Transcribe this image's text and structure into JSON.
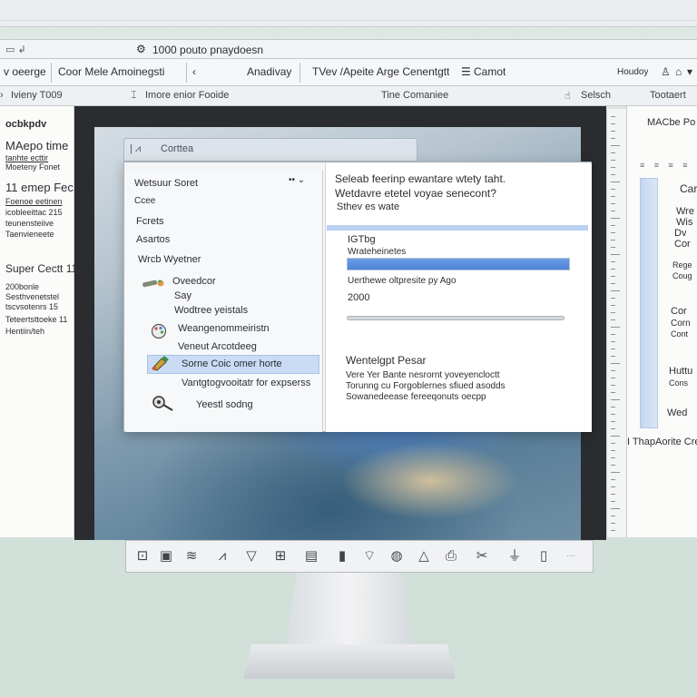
{
  "title_bar": {
    "menu_icon": "menu-icon",
    "logo_icon": "cog-logo-icon",
    "title": "1000 pouto pnaydoesn"
  },
  "tab_bar": {
    "tabs": [
      "v oeerge",
      "Coor Mele Amoinegsti",
      "Anadivay",
      "TVev /Apeite Arge Cenentgtt",
      "Camot"
    ],
    "right_label": "Houdoy",
    "right_icons": [
      "user-icon",
      "lock-icon",
      "chevron-down-icon"
    ]
  },
  "toolbar": {
    "left_label": "Ivieny T009",
    "center_label": "Imore enior Fooide",
    "time_label": "Tine Comaniee",
    "select_label": "Selsch",
    "right_label": "Tootaert"
  },
  "left_panel": {
    "heading": "ocbkpdv",
    "title": "MAepo time",
    "lines": [
      "tanhte ecttir",
      "Moeteny Fonet"
    ],
    "subhead": "11 emep Fec",
    "sublines": [
      "Foenoe eetinen",
      "icobleeittac 215",
      "teunensteiive",
      "Taenvieneete"
    ],
    "section": "Super Cectt 11",
    "section_lines": [
      "200bonle",
      "Sesthvenetstel",
      "tscvsotenrs 15",
      "Teteertsttoeke 11",
      "Hentiin/teh"
    ]
  },
  "right_panel": {
    "title": "MACbe Po",
    "lines": [
      "Car",
      "Wre",
      "Wis",
      "Dv",
      "Cor",
      "Rege",
      "Coug",
      "Cor",
      "Corn",
      "Cont",
      "Huttu",
      "Cons",
      "Wed"
    ],
    "footer": "I ThapAorite Cre"
  },
  "back_window": {
    "title": "Corttea"
  },
  "dialog": {
    "left": {
      "header": "Wetsuur Soret",
      "items": [
        "Ccee",
        "Fcrets",
        "Asartos",
        "Wrcb Wyetner",
        "Oveedcor",
        "Say",
        "Wodtree yeistals",
        "Weangenommeiristn",
        "Veneut Arcotdeeg",
        "Sorne Coic omer horte",
        "Vantgtogvooitatr for expserss",
        "Yeestl sodng"
      ],
      "selected_index": 9
    },
    "right": {
      "heading_line1": "Seleab feerinp ewantare wtety taht.",
      "heading_line2": "Wetdavre etetel voyae senecont?",
      "subheading": "Sthev es wate",
      "field_label": "IGTbg",
      "field_value": "Wrateheinetes",
      "progress_percent": 100,
      "progress_caption": "Uerthewe oltpresite py Ago",
      "number_value": "2000",
      "section_title": "Wentelgpt Pesar",
      "section_lines": [
        "Vere Yer Bante nesrornt yoveyencloctt",
        "Torunng cu Forgoblernes sfiued asodds",
        "Sowanedeease fereeqonuts oecpp"
      ]
    }
  },
  "taskbar": {
    "icons": [
      "app-icon",
      "presentation-icon",
      "chart-icon",
      "vector-icon",
      "filter-icon",
      "image-icon",
      "document-icon",
      "battery-icon",
      "wifi-icon",
      "globe-icon",
      "triangle-icon",
      "print-icon",
      "scissors-icon",
      "bottle-icon",
      "book-icon"
    ]
  },
  "colors": {
    "accent": "#4d82d8",
    "selection": "#c9dcf4",
    "background": "#d3e2dc"
  }
}
